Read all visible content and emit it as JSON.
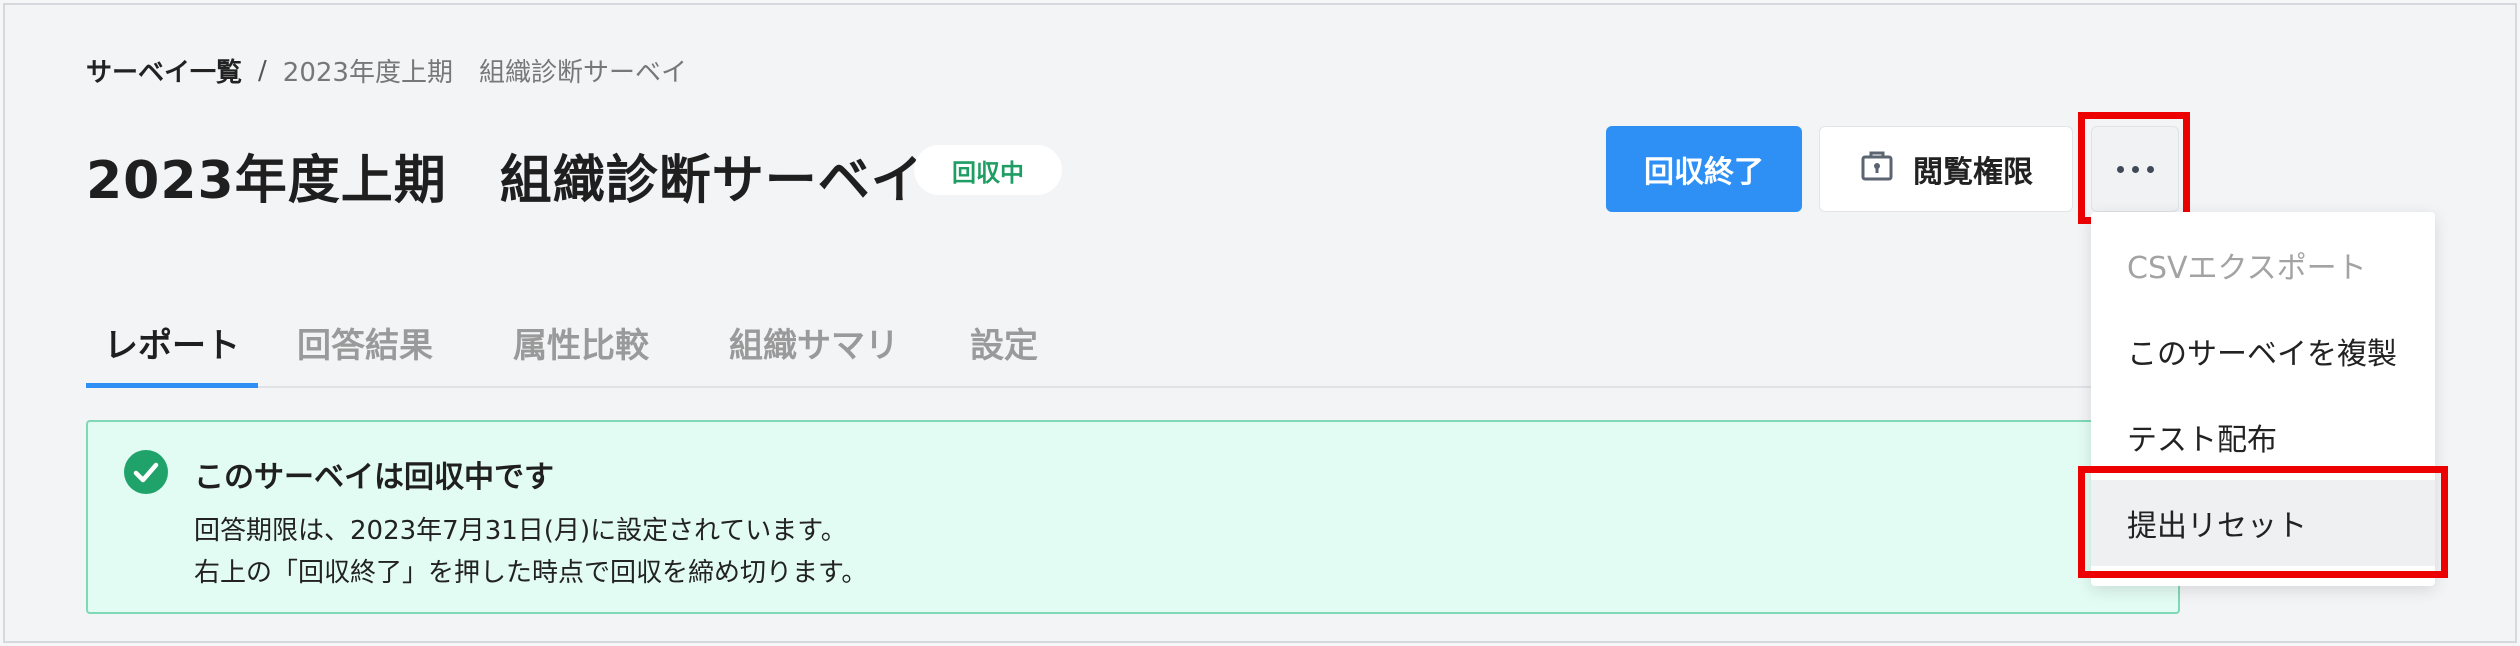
{
  "breadcrumb": {
    "link": "サーベイ一覧",
    "separator": "/",
    "current": "2023年度上期　組織診断サーベイ"
  },
  "header": {
    "title": "2023年度上期　組織診断サーベイ",
    "status": "回収中",
    "status_color": "#1f9e63"
  },
  "toolbar": {
    "end_collection_label": "回収終了",
    "view_permission_label": "閲覧権限",
    "view_permission_icon": "lock-icon",
    "more_icon": "more-horizontal-icon",
    "primary_color": "#2e8ff4"
  },
  "tabs": [
    {
      "label": "レポート",
      "active": true
    },
    {
      "label": "回答結果",
      "active": false
    },
    {
      "label": "属性比較",
      "active": false
    },
    {
      "label": "組織サマリ",
      "active": false
    },
    {
      "label": "設定",
      "active": false
    }
  ],
  "notice": {
    "icon": "check-circle-icon",
    "title": "このサーベイは回収中です",
    "line1": "回答期限は、2023年7月31日(月)に設定されています。",
    "line2": "右上の「回収終了」を押した時点で回収を締め切ります。"
  },
  "menu": {
    "items": [
      {
        "label": "CSVエクスポート",
        "disabled": true
      },
      {
        "label": "このサーベイを複製",
        "disabled": false
      },
      {
        "label": "テスト配布",
        "disabled": false
      },
      {
        "label": "提出リセット",
        "disabled": false
      }
    ]
  },
  "highlight_color": "#ec0000"
}
